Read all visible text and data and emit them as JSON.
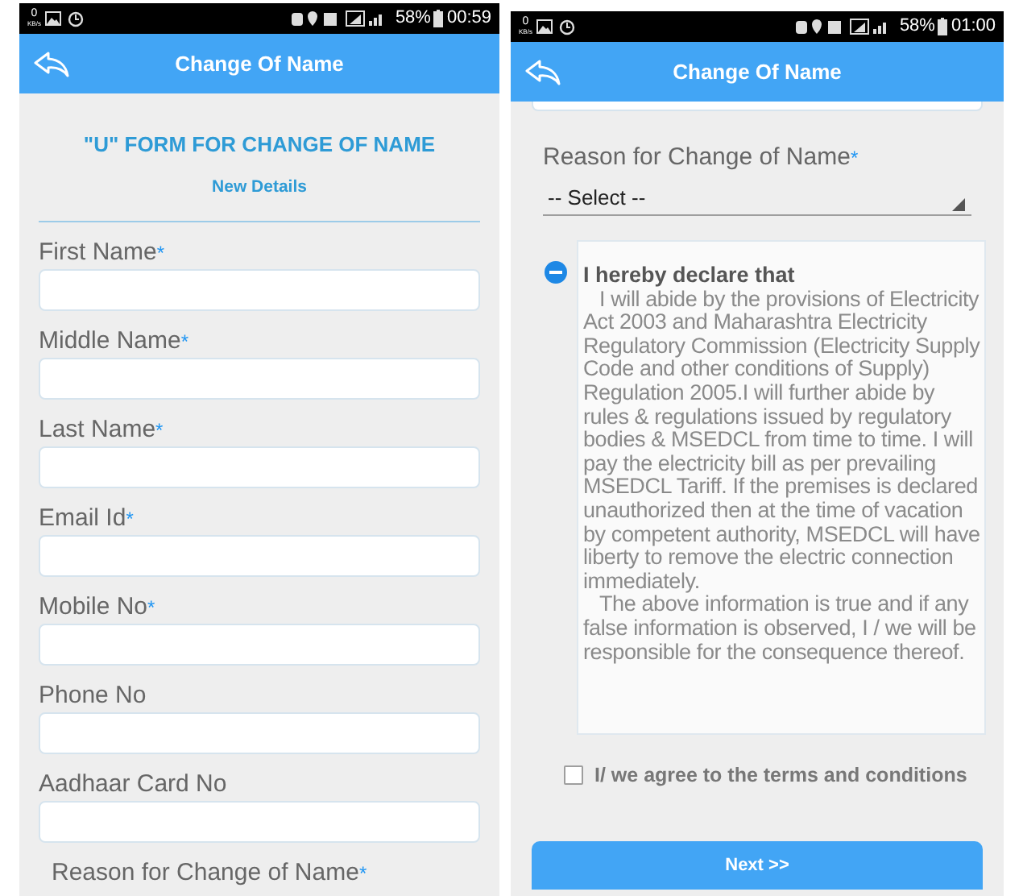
{
  "left_screen": {
    "status_bar": {
      "net_speed": "0",
      "net_unit": "KB/s",
      "battery": "58%",
      "time": "00:59"
    },
    "header": {
      "title": "Change Of Name"
    },
    "form": {
      "title": "\"U\" FORM FOR CHANGE OF NAME",
      "subtitle": "New Details",
      "fields": [
        {
          "label": "First Name",
          "required_mark": "*"
        },
        {
          "label": "Middle Name",
          "required_mark": "*"
        },
        {
          "label": "Last Name",
          "required_mark": "*"
        },
        {
          "label": "Email Id",
          "required_mark": "*"
        },
        {
          "label": "Mobile No",
          "required_mark": "*"
        },
        {
          "label": "Phone No"
        },
        {
          "label": "Aadhaar Card No"
        }
      ],
      "cut_label": {
        "label": "Reason for Change of Name",
        "required_mark": "*"
      }
    }
  },
  "right_screen": {
    "status_bar": {
      "net_speed": "0",
      "net_unit": "KB/s",
      "battery": "58%",
      "time": "01:00"
    },
    "header": {
      "title": "Change Of Name"
    },
    "reason_field": {
      "label": "Reason for Change of Name",
      "required_mark": "*",
      "value": "-- Select --"
    },
    "declaration": {
      "expanded": true,
      "heading": "I hereby declare that",
      "paragraphs": [
        "I will abide by the provisions of Electricity Act 2003 and Maharashtra Electricity Regulatory Commission (Electricity Supply Code and other conditions of Supply) Regulation 2005.I will further abide by rules & regulations issued by regulatory bodies & MSEDCL from time to time. I will pay the electricity bill as per prevailing MSEDCL Tariff. If the premises is declared unauthorized then at the time of vacation by competent authority, MSEDCL will have liberty to remove the electric connection immediately.",
        "The above information is true and if any false information is observed, I / we will be responsible for the consequence thereof."
      ]
    },
    "agree": {
      "label": "I/ we agree to the terms and conditions",
      "checked": false
    },
    "next_button": "Next >>"
  }
}
